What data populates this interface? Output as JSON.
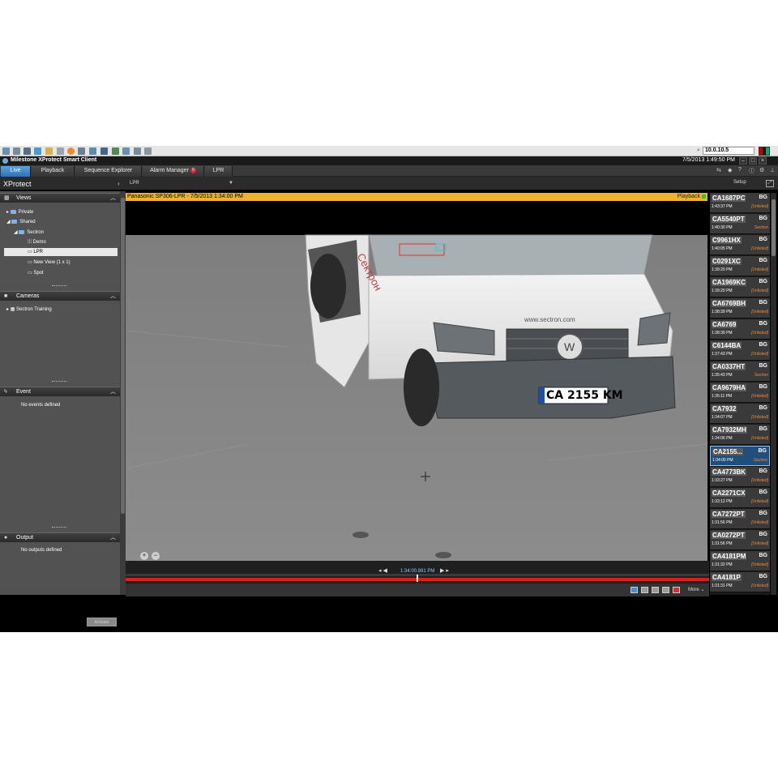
{
  "taskbar": {
    "address": "10.0.10.5",
    "search_glyph": "⌕"
  },
  "titlebar": {
    "title": "Milestone XProtect Smart Client",
    "datetime": "7/5/2013 1:49:50 PM"
  },
  "tabs": [
    {
      "label": "Live",
      "active": true
    },
    {
      "label": "Playback",
      "active": false
    },
    {
      "label": "Sequence Explorer",
      "active": false
    },
    {
      "label": "Alarm Manager",
      "active": false,
      "badge": "9"
    },
    {
      "label": "LPR",
      "active": false
    }
  ],
  "toolbar": {
    "brand": "XProtect",
    "view_name": "LPR",
    "setup_label": "Setup"
  },
  "views": {
    "header": "Views",
    "tree": [
      {
        "label": "Private"
      },
      {
        "label": "Shared"
      },
      {
        "label": "Sectron"
      },
      {
        "label": "Demo"
      },
      {
        "label": "LPR",
        "selected": true
      },
      {
        "label": "New View (1 x 1)"
      },
      {
        "label": "Spot"
      }
    ]
  },
  "cameras": {
    "header": "Cameras",
    "tree": [
      {
        "label": "Sectron Training"
      }
    ]
  },
  "event": {
    "header": "Event",
    "empty": "No events defined",
    "activate_label": "Activate"
  },
  "output": {
    "header": "Output",
    "empty": "No outputs defined"
  },
  "camera_view": {
    "header": "Panasonic SP306-LPR - 7/5/2013 1:34:00 PM",
    "mode": "Playback",
    "plate_in_image": "CA 2155 KM",
    "van_text": "Сектрон",
    "van_url": "www.sectron.com"
  },
  "playback": {
    "time": "1:34:00.881 PM",
    "more_label": "More"
  },
  "lpr_list": [
    {
      "plate": "CA1687PC",
      "country": "BG",
      "time": "1:43:37 PM",
      "list": "[Unlisted]"
    },
    {
      "plate": "CA5540PT",
      "country": "BG",
      "time": "1:40:30 PM",
      "list": "Sectron"
    },
    {
      "plate": "C9961HX",
      "country": "BG",
      "time": "1:40:05 PM",
      "list": "[Unlisted]"
    },
    {
      "plate": "C0291XC",
      "country": "BG",
      "time": "1:39:20 PM",
      "list": "[Unlisted]"
    },
    {
      "plate": "CA1969KC",
      "country": "BG",
      "time": "1:39:20 PM",
      "list": "[Unlisted]"
    },
    {
      "plate": "CA6769BH",
      "country": "BG",
      "time": "1:38:39 PM",
      "list": "[Unlisted]"
    },
    {
      "plate": "CA6769",
      "country": "BG",
      "time": "1:38:39 PM",
      "list": "[Unlisted]"
    },
    {
      "plate": "C6144BA",
      "country": "BG",
      "time": "1:37:43 PM",
      "list": "[Unlisted]"
    },
    {
      "plate": "CA0337HT",
      "country": "BG",
      "time": "1:35:43 PM",
      "list": "Sectron"
    },
    {
      "plate": "CA9679HA",
      "country": "BG",
      "time": "1:35:11 PM",
      "list": "[Unlisted]"
    },
    {
      "plate": "CA7932",
      "country": "BG",
      "time": "1:34:07 PM",
      "list": "[Unlisted]"
    },
    {
      "plate": "CA7932MH",
      "country": "BG",
      "time": "1:34:06 PM",
      "list": "[Unlisted]"
    },
    {
      "plate": "CA2155...",
      "country": "BG",
      "time": "1:34:00 PM",
      "list": "Sectron",
      "selected": true
    },
    {
      "plate": "CA4773BK",
      "country": "BG",
      "time": "1:33:27 PM",
      "list": "[Unlisted]"
    },
    {
      "plate": "CA2271CX",
      "country": "BG",
      "time": "1:33:12 PM",
      "list": "[Unlisted]"
    },
    {
      "plate": "CA7272PT",
      "country": "BG",
      "time": "1:31:56 PM",
      "list": "[Unlisted]"
    },
    {
      "plate": "CA0272PT",
      "country": "BG",
      "time": "1:31:56 PM",
      "list": "[Unlisted]"
    },
    {
      "plate": "CA4181PM",
      "country": "BG",
      "time": "1:31:32 PM",
      "list": "[Unlisted]"
    },
    {
      "plate": "CA4181P",
      "country": "BG",
      "time": "1:31:31 PM",
      "list": "[Unlisted]"
    }
  ],
  "colors": {
    "accent": "#2d72b5",
    "camera_header": "#f0b22e",
    "timeline": "#d62020",
    "unlisted": "#f58a3a"
  }
}
